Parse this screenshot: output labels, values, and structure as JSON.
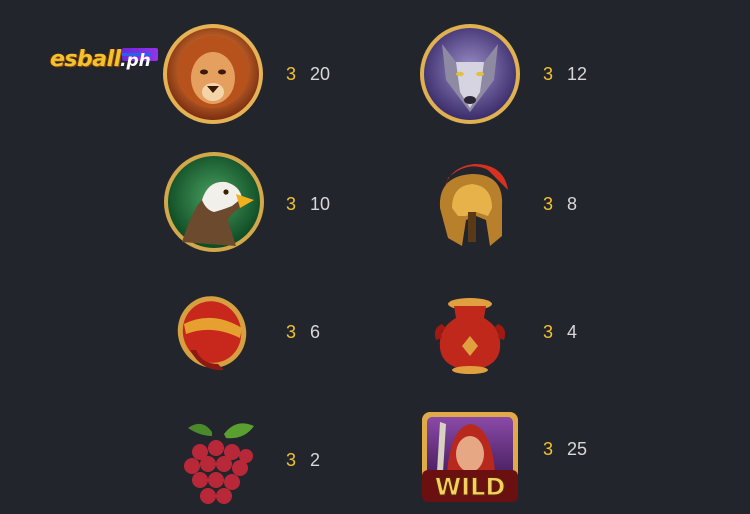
{
  "paytable": {
    "items": [
      {
        "symbol": "lion",
        "count": "3",
        "value": "20"
      },
      {
        "symbol": "wolf",
        "count": "3",
        "value": "12"
      },
      {
        "symbol": "eagle",
        "count": "3",
        "value": "10"
      },
      {
        "symbol": "helmet",
        "count": "3",
        "value": "8"
      },
      {
        "symbol": "shield",
        "count": "3",
        "value": "6"
      },
      {
        "symbol": "vase",
        "count": "3",
        "value": "4"
      },
      {
        "symbol": "grapes",
        "count": "3",
        "value": "2"
      },
      {
        "symbol": "wild",
        "count": "3",
        "value": "25",
        "label": "WILD"
      }
    ]
  },
  "logo": {
    "brand": "esball",
    "suffix": "ph"
  },
  "colors": {
    "background": "#23252c",
    "count": "#f2c230",
    "value": "#d8d8d8"
  }
}
